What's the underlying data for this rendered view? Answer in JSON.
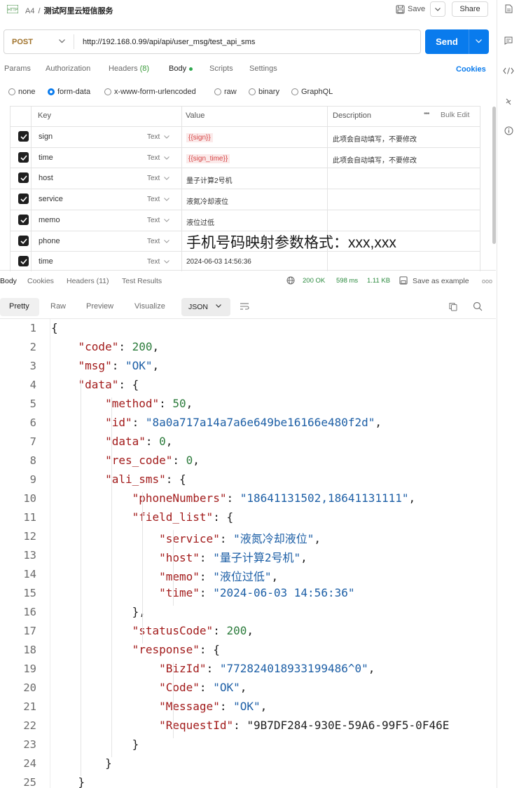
{
  "workspace": "A4",
  "request_name": "测试阿里云短信服务",
  "toolbar": {
    "save_label": "Save",
    "share_label": "Share"
  },
  "request": {
    "method": "POST",
    "url": "http://192.168.0.99/api/api/user_msg/test_api_sms",
    "send_label": "Send"
  },
  "req_tabs": {
    "params": "Params",
    "authorization": "Authorization",
    "headers": "Headers",
    "headers_count": "(8)",
    "body": "Body",
    "scripts": "Scripts",
    "settings": "Settings",
    "cookies": "Cookies"
  },
  "body_types": {
    "none": "none",
    "form_data": "form-data",
    "urlencoded": "x-www-form-urlencoded",
    "raw": "raw",
    "binary": "binary",
    "graphql": "GraphQL",
    "selected": "form-data"
  },
  "params_table": {
    "headers": {
      "key": "Key",
      "value": "Value",
      "description": "Description",
      "bulk_edit": "Bulk Edit",
      "more": "•••"
    },
    "rows": [
      {
        "key": "sign",
        "type": "Text",
        "value": "{{sign}}",
        "description": "此项会自动填写，不要修改"
      },
      {
        "key": "time",
        "type": "Text",
        "value": "{{sign_time}}",
        "description": "此项会自动填写，不要修改"
      },
      {
        "key": "host",
        "type": "Text",
        "value": "量子计算2号机",
        "description": ""
      },
      {
        "key": "service",
        "type": "Text",
        "value": "液氮冷却液位",
        "description": ""
      },
      {
        "key": "memo",
        "type": "Text",
        "value": "液位过低",
        "description": ""
      },
      {
        "key": "phone",
        "type": "Text",
        "value": "手机号码映射参数格式：xxx,xxx",
        "description": ""
      },
      {
        "key": "time",
        "type": "Text",
        "value": "2024-06-03 14:56:36",
        "description": ""
      }
    ]
  },
  "response_tabs": {
    "body": "Body",
    "cookies": "Cookies",
    "headers": "Headers",
    "headers_count": "(11)",
    "test_results": "Test Results",
    "status": "200 OK",
    "time": "598 ms",
    "size": "1.11 KB",
    "save_example": "Save as example",
    "more": "ooo"
  },
  "view_tabs": {
    "pretty": "Pretty",
    "raw": "Raw",
    "preview": "Preview",
    "visualize": "Visualize",
    "format": "JSON"
  },
  "code_lines": [
    "{",
    "    \"code\": 200,",
    "    \"msg\": \"OK\",",
    "    \"data\": {",
    "        \"method\": 50,",
    "        \"id\": \"8a0a717a14a7a6e649be16166e480f2d\",",
    "        \"data\": 0,",
    "        \"res_code\": 0,",
    "        \"ali_sms\": {",
    "            \"phoneNumbers\": \"18641131502,18641131111\",",
    "            \"field_list\": {",
    "                \"service\": \"液氮冷却液位\",",
    "                \"host\": \"量子计算2号机\",",
    "                \"memo\": \"液位过低\",",
    "                \"time\": \"2024-06-03 14:56:36\"",
    "            },",
    "            \"statusCode\": 200,",
    "            \"response\": {",
    "                \"BizId\": \"772824018933199486^0\",",
    "                \"Code\": \"OK\",",
    "                \"Message\": \"OK\",",
    "                \"RequestId\": \"9B7DF284-930E-59A6-99F5-0F46E",
    "            }",
    "        }",
    "    }"
  ],
  "colors": {
    "accent": "#097bed",
    "method": "#a0722a",
    "json_key": "#a21b1b",
    "json_string": "#1d5fa6",
    "json_number": "#2b7b3b",
    "variable": "#d64545"
  },
  "icons": [
    "http-request-icon",
    "save-icon",
    "chevron-down-icon",
    "globe-icon",
    "copy-icon",
    "search-icon",
    "wrap-icon",
    "document-icon",
    "comment-icon",
    "code-icon",
    "history-icon",
    "info-icon"
  ]
}
